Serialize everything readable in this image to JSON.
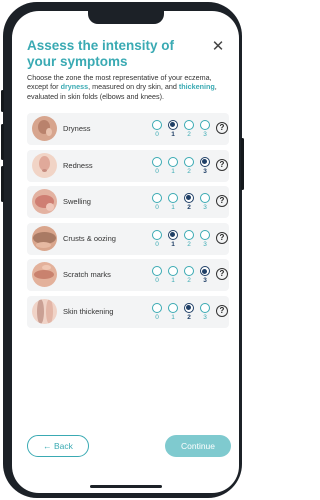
{
  "header": {
    "title": "Assess the intensity of your symptoms",
    "close_icon": "close-icon"
  },
  "intro": {
    "text_before": "Choose the zone the most representative of your eczema, except for ",
    "highlight_1": "dryness",
    "text_middle": ", measured on dry skin, and ",
    "highlight_2": "thickening",
    "text_after": ", evaluated in skin folds (elbows and knees)."
  },
  "scale_numbers": [
    "0",
    "1",
    "2",
    "3"
  ],
  "symptoms": [
    {
      "label": "Dryness",
      "selected": 1
    },
    {
      "label": "Redness",
      "selected": 3
    },
    {
      "label": "Swelling",
      "selected": 2
    },
    {
      "label": "Crusts & oozing",
      "selected": 1
    },
    {
      "label": "Scratch marks",
      "selected": 3
    },
    {
      "label": "Skin thickening",
      "selected": 2
    }
  ],
  "help_label": "?",
  "footer": {
    "back_label": "Back",
    "back_icon": "arrow-left-icon",
    "continue_label": "Continue"
  },
  "colors": {
    "accent": "#3aaab3",
    "selected": "#1f3f66",
    "continue_bg": "#7fcacf",
    "row_bg": "#f3f4f5"
  }
}
